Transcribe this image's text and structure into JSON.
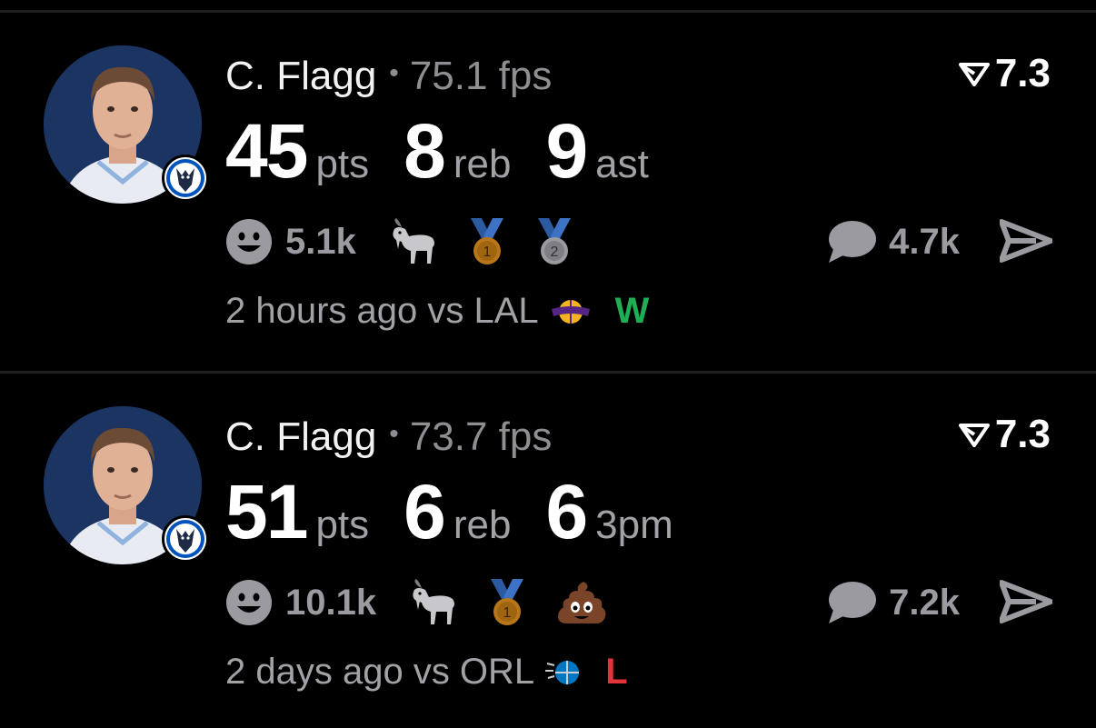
{
  "feed": [
    {
      "player": "C. Flagg",
      "fps": "75.1 fps",
      "rating": "7.3",
      "stats": [
        {
          "value": "45",
          "unit": "pts"
        },
        {
          "value": "8",
          "unit": "reb"
        },
        {
          "value": "9",
          "unit": "ast"
        }
      ],
      "likes": "5.1k",
      "badges": [
        "goat-icon",
        "gold-medal-icon",
        "silver-medal-icon"
      ],
      "medal_numbers": {
        "gold": "1",
        "silver": "2"
      },
      "comments": "4.7k",
      "time": "2 hours ago vs LAL",
      "opponent_logo": "lakers-logo-icon",
      "result": "W",
      "result_color": "#1fae55"
    },
    {
      "player": "C. Flagg",
      "fps": "73.7 fps",
      "rating": "7.3",
      "stats": [
        {
          "value": "51",
          "unit": "pts"
        },
        {
          "value": "6",
          "unit": "reb"
        },
        {
          "value": "6",
          "unit": "3pm"
        }
      ],
      "likes": "10.1k",
      "badges": [
        "goat-icon",
        "gold-medal-icon",
        "poop-icon"
      ],
      "medal_numbers": {
        "gold": "1"
      },
      "comments": "7.2k",
      "time": "2 days ago vs ORL",
      "opponent_logo": "magic-logo-icon",
      "result": "L",
      "result_color": "#e5333b"
    }
  ],
  "colors": {
    "background": "#000000",
    "muted": "#8e8e93",
    "avatar_bg": "#1b3461"
  }
}
